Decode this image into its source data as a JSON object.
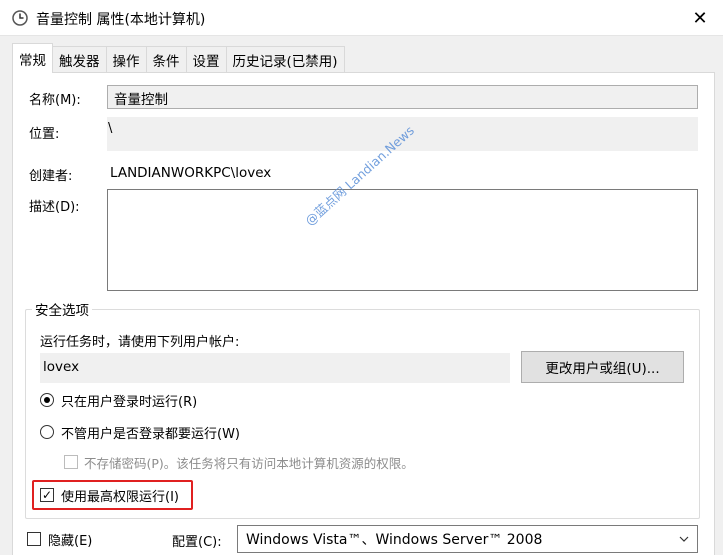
{
  "window": {
    "title": "音量控制 属性(本地计算机)",
    "icon": "task-clock-icon",
    "close_label": "✕"
  },
  "tabs": [
    {
      "label": "常规",
      "active": true
    },
    {
      "label": "触发器",
      "active": false
    },
    {
      "label": "操作",
      "active": false
    },
    {
      "label": "条件",
      "active": false
    },
    {
      "label": "设置",
      "active": false
    },
    {
      "label": "历史记录(已禁用)",
      "active": false
    }
  ],
  "general": {
    "name_label": "名称(M):",
    "name_value": "音量控制",
    "location_label": "位置:",
    "location_value": "\\",
    "author_label": "创建者:",
    "author_value": "LANDIANWORKPC\\lovex",
    "description_label": "描述(D):",
    "description_value": ""
  },
  "security": {
    "legend": "安全选项",
    "run_as_label": "运行任务时，请使用下列用户帐户:",
    "user_value": "lovex",
    "change_user_button": "更改用户或组(U)...",
    "radio_logged_on": "只在用户登录时运行(R)",
    "radio_logged_on_selected": true,
    "radio_whether": "不管用户是否登录都要运行(W)",
    "radio_whether_selected": false,
    "no_store_password": "不存储密码(P)。该任务将只有访问本地计算机资源的权限。",
    "no_store_password_checked": false,
    "highest_privileges": "使用最高权限运行(I)",
    "highest_privileges_checked": true
  },
  "bottom": {
    "hidden_label": "隐藏(E)",
    "hidden_checked": false,
    "configure_label": "配置(C):",
    "configure_value": "Windows Vista™、Windows Server™ 2008"
  },
  "watermark": "@蓝点网 Landian.News",
  "colors": {
    "highlight_border": "#e02020",
    "watermark": "#5a8fd8"
  }
}
